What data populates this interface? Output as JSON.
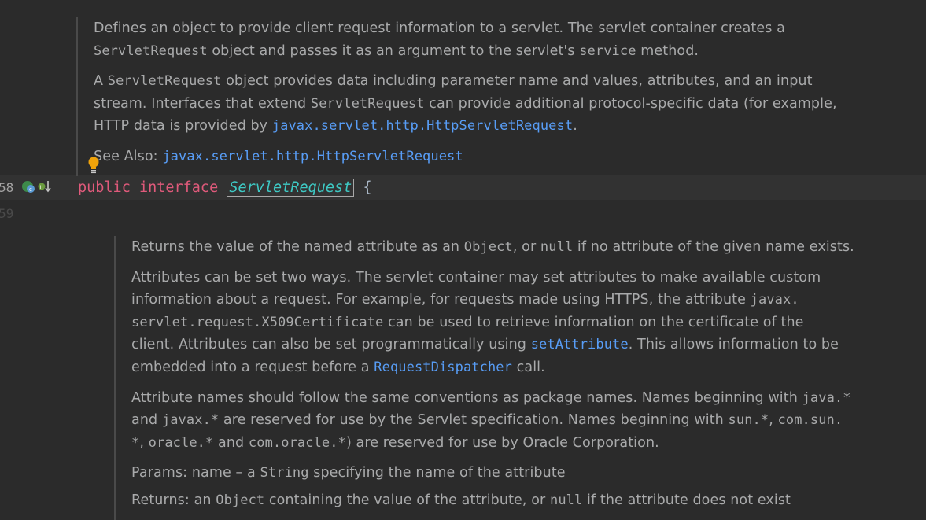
{
  "gutter": {
    "line_a": "58",
    "line_b": "59"
  },
  "doc_class": {
    "p1_a": "Defines an object to provide client request information to a servlet. The servlet container creates a",
    "p1_b_code": "ServletRequest",
    "p1_b_text": " object and passes it as an argument to the servlet's ",
    "p1_b_code2": "service",
    "p1_b_end": " method.",
    "p2_a": "A ",
    "p2_code": "ServletRequest",
    "p2_b": " object provides data including parameter name and values, attributes, and an input",
    "p2_c": "stream. Interfaces that extend ",
    "p2_code2": "ServletRequest",
    "p2_d": " can provide additional protocol-specific data (for example,",
    "p2_e": "HTTP data is provided by ",
    "p2_link": "javax.servlet.http.HttpServletRequest",
    "p2_end": ".",
    "see_also_label": "See Also: ",
    "see_also_link": "javax.servlet.http.HttpServletRequest"
  },
  "code": {
    "kw1": "public",
    "kw2": "interface",
    "class_name": "ServletRequest",
    "brace": "{"
  },
  "doc_method": {
    "p1_a": "Returns the value of the named attribute as an ",
    "p1_code": "Object",
    "p1_b": ", or ",
    "p1_code2": "null",
    "p1_c": " if no attribute of the given name exists.",
    "p2_a": "Attributes can be set two ways. The servlet container may set attributes to make available custom",
    "p2_b": "information about a request. For example, for requests made using HTTPS, the attribute ",
    "p2_code1": "javax.",
    "p2_code2": "servlet.request.X509Certificate",
    "p2_c": " can be used to retrieve information on the certificate of the",
    "p2_d": "client. Attributes can also be set programmatically using ",
    "p2_link1": "setAttribute",
    "p2_e": ". This allows information to be",
    "p2_f": "embedded into a request before a ",
    "p2_link2": "RequestDispatcher",
    "p2_g": " call.",
    "p3_a": "Attribute names should follow the same conventions as package names. Names beginning with ",
    "p3_code1": "java.*",
    "p3_b": "and ",
    "p3_code2": "javax.*",
    "p3_c": " are reserved for use by the Servlet specification. Names beginning with ",
    "p3_code3": "sun.*",
    "p3_d": ", ",
    "p3_code4": "com.sun.",
    "p3_code5": "*",
    "p3_e": ", ",
    "p3_code6": "oracle.*",
    "p3_f": " and ",
    "p3_code7": "com.oracle.*",
    "p3_g": ") are reserved for use by Oracle Corporation.",
    "params_label": "Params: ",
    "params_a": " name – a ",
    "params_code": "String",
    "params_b": " specifying the name of the attribute",
    "returns_label": "Returns: ",
    "returns_a": "an ",
    "returns_code": "Object",
    "returns_b": " containing the value of the attribute, or ",
    "returns_code2": "null",
    "returns_c": " if the attribute does not exist"
  }
}
